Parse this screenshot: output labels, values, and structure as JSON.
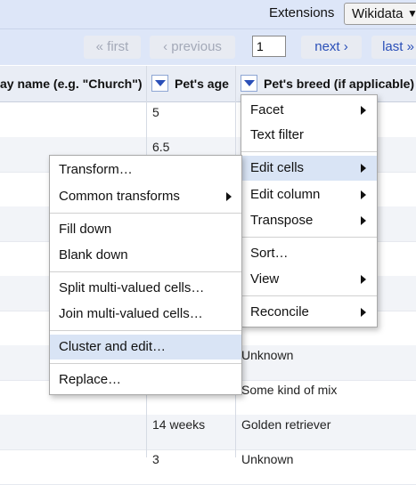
{
  "topbar": {
    "extensions_label": "Extensions",
    "wikidata_label": "Wikidata"
  },
  "pager": {
    "first": "« first",
    "previous": "‹ previous",
    "page_value": "1",
    "next": "next ›",
    "last": "last »"
  },
  "columns": {
    "display_name": "ay name (e.g. \"Church\")",
    "pets_age": "Pet's age",
    "pets_breed": "Pet's breed (if applicable)"
  },
  "rows": [
    {
      "age": "5",
      "breed": ""
    },
    {
      "age": "6.5",
      "breed": ""
    },
    {
      "age": "",
      "breed": ""
    },
    {
      "age": "",
      "breed": ""
    },
    {
      "age": "",
      "breed": ""
    },
    {
      "age": "",
      "breed": ""
    },
    {
      "age": "",
      "breed": ""
    },
    {
      "age": "",
      "breed": "Unknown"
    },
    {
      "age": "",
      "breed": "Some kind of mix"
    },
    {
      "age": "14 weeks",
      "breed": "Golden retriever"
    },
    {
      "age": "3",
      "breed": "Unknown"
    }
  ],
  "column_menu": {
    "items": [
      "Facet",
      "Text filter",
      "Edit cells",
      "Edit column",
      "Transpose",
      "Sort…",
      "View",
      "Reconcile"
    ]
  },
  "edit_cells_menu": {
    "items": [
      "Transform…",
      "Common transforms",
      "Fill down",
      "Blank down",
      "Split multi-valued cells…",
      "Join multi-valued cells…",
      "Cluster and edit…",
      "Replace…"
    ]
  }
}
